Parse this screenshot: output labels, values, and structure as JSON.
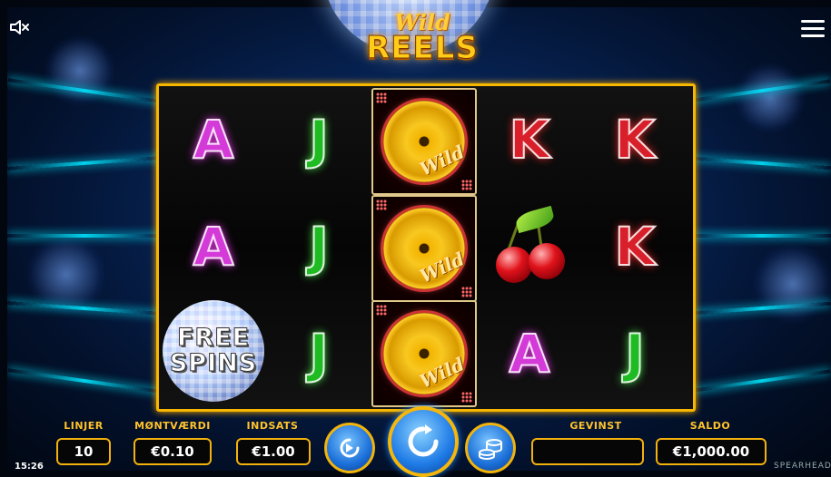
{
  "game": {
    "logo_line1": "Wild",
    "logo_line2": "REELS"
  },
  "reels": [
    [
      "A",
      "A",
      "FREE SPINS"
    ],
    [
      "J",
      "J",
      "J"
    ],
    [
      "wild",
      "wild",
      "wild"
    ],
    [
      "K",
      "cherry",
      "A"
    ],
    [
      "K",
      "K",
      "J"
    ]
  ],
  "wild_label": "Wild",
  "free_spins": {
    "line1": "FREE",
    "line2": "SPINS"
  },
  "controls": {
    "lines_label": "LINJER",
    "lines_value": "10",
    "coin_label": "MØNTVÆRDI",
    "coin_value": "€0.10",
    "bet_label": "INDSATS",
    "bet_value": "€1.00",
    "win_label": "GEVINST",
    "win_value": "",
    "balance_label": "SALDO",
    "balance_value": "€1,000.00"
  },
  "status": {
    "clock": "15:26",
    "brand": "SPEARHEAD"
  },
  "icons": {
    "sound": "sound-mute-icon",
    "menu": "hamburger-menu-icon",
    "autoplay": "autoplay-icon",
    "spin": "spin-arrow-icon",
    "coins": "coin-stack-icon"
  },
  "colors": {
    "accent": "#f5b700",
    "label": "#ffc32b"
  }
}
